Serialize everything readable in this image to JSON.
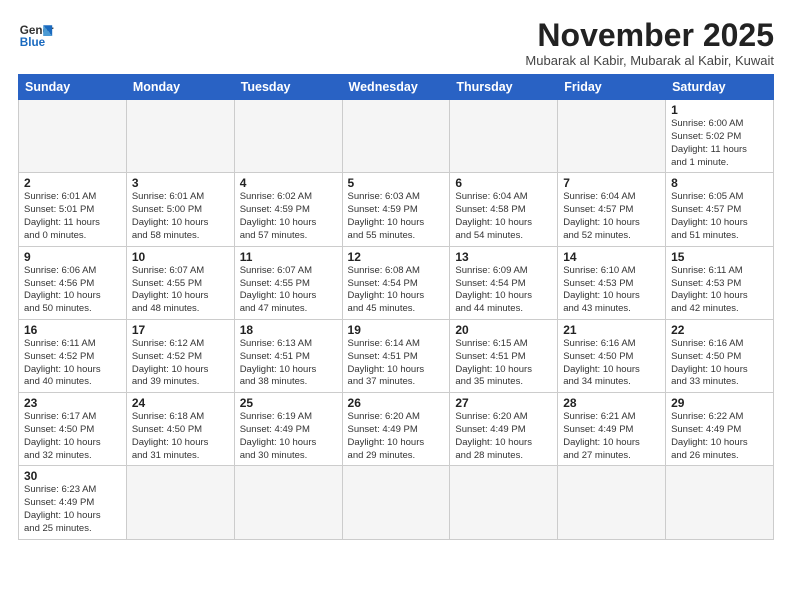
{
  "header": {
    "logo_line1": "General",
    "logo_line2": "Blue",
    "month_title": "November 2025",
    "subtitle": "Mubarak al Kabir, Mubarak al Kabir, Kuwait"
  },
  "weekdays": [
    "Sunday",
    "Monday",
    "Tuesday",
    "Wednesday",
    "Thursday",
    "Friday",
    "Saturday"
  ],
  "weeks": [
    [
      {
        "day": "",
        "info": ""
      },
      {
        "day": "",
        "info": ""
      },
      {
        "day": "",
        "info": ""
      },
      {
        "day": "",
        "info": ""
      },
      {
        "day": "",
        "info": ""
      },
      {
        "day": "",
        "info": ""
      },
      {
        "day": "1",
        "info": "Sunrise: 6:00 AM\nSunset: 5:02 PM\nDaylight: 11 hours\nand 1 minute."
      }
    ],
    [
      {
        "day": "2",
        "info": "Sunrise: 6:01 AM\nSunset: 5:01 PM\nDaylight: 11 hours\nand 0 minutes."
      },
      {
        "day": "3",
        "info": "Sunrise: 6:01 AM\nSunset: 5:00 PM\nDaylight: 10 hours\nand 58 minutes."
      },
      {
        "day": "4",
        "info": "Sunrise: 6:02 AM\nSunset: 4:59 PM\nDaylight: 10 hours\nand 57 minutes."
      },
      {
        "day": "5",
        "info": "Sunrise: 6:03 AM\nSunset: 4:59 PM\nDaylight: 10 hours\nand 55 minutes."
      },
      {
        "day": "6",
        "info": "Sunrise: 6:04 AM\nSunset: 4:58 PM\nDaylight: 10 hours\nand 54 minutes."
      },
      {
        "day": "7",
        "info": "Sunrise: 6:04 AM\nSunset: 4:57 PM\nDaylight: 10 hours\nand 52 minutes."
      },
      {
        "day": "8",
        "info": "Sunrise: 6:05 AM\nSunset: 4:57 PM\nDaylight: 10 hours\nand 51 minutes."
      }
    ],
    [
      {
        "day": "9",
        "info": "Sunrise: 6:06 AM\nSunset: 4:56 PM\nDaylight: 10 hours\nand 50 minutes."
      },
      {
        "day": "10",
        "info": "Sunrise: 6:07 AM\nSunset: 4:55 PM\nDaylight: 10 hours\nand 48 minutes."
      },
      {
        "day": "11",
        "info": "Sunrise: 6:07 AM\nSunset: 4:55 PM\nDaylight: 10 hours\nand 47 minutes."
      },
      {
        "day": "12",
        "info": "Sunrise: 6:08 AM\nSunset: 4:54 PM\nDaylight: 10 hours\nand 45 minutes."
      },
      {
        "day": "13",
        "info": "Sunrise: 6:09 AM\nSunset: 4:54 PM\nDaylight: 10 hours\nand 44 minutes."
      },
      {
        "day": "14",
        "info": "Sunrise: 6:10 AM\nSunset: 4:53 PM\nDaylight: 10 hours\nand 43 minutes."
      },
      {
        "day": "15",
        "info": "Sunrise: 6:11 AM\nSunset: 4:53 PM\nDaylight: 10 hours\nand 42 minutes."
      }
    ],
    [
      {
        "day": "16",
        "info": "Sunrise: 6:11 AM\nSunset: 4:52 PM\nDaylight: 10 hours\nand 40 minutes."
      },
      {
        "day": "17",
        "info": "Sunrise: 6:12 AM\nSunset: 4:52 PM\nDaylight: 10 hours\nand 39 minutes."
      },
      {
        "day": "18",
        "info": "Sunrise: 6:13 AM\nSunset: 4:51 PM\nDaylight: 10 hours\nand 38 minutes."
      },
      {
        "day": "19",
        "info": "Sunrise: 6:14 AM\nSunset: 4:51 PM\nDaylight: 10 hours\nand 37 minutes."
      },
      {
        "day": "20",
        "info": "Sunrise: 6:15 AM\nSunset: 4:51 PM\nDaylight: 10 hours\nand 35 minutes."
      },
      {
        "day": "21",
        "info": "Sunrise: 6:16 AM\nSunset: 4:50 PM\nDaylight: 10 hours\nand 34 minutes."
      },
      {
        "day": "22",
        "info": "Sunrise: 6:16 AM\nSunset: 4:50 PM\nDaylight: 10 hours\nand 33 minutes."
      }
    ],
    [
      {
        "day": "23",
        "info": "Sunrise: 6:17 AM\nSunset: 4:50 PM\nDaylight: 10 hours\nand 32 minutes."
      },
      {
        "day": "24",
        "info": "Sunrise: 6:18 AM\nSunset: 4:50 PM\nDaylight: 10 hours\nand 31 minutes."
      },
      {
        "day": "25",
        "info": "Sunrise: 6:19 AM\nSunset: 4:49 PM\nDaylight: 10 hours\nand 30 minutes."
      },
      {
        "day": "26",
        "info": "Sunrise: 6:20 AM\nSunset: 4:49 PM\nDaylight: 10 hours\nand 29 minutes."
      },
      {
        "day": "27",
        "info": "Sunrise: 6:20 AM\nSunset: 4:49 PM\nDaylight: 10 hours\nand 28 minutes."
      },
      {
        "day": "28",
        "info": "Sunrise: 6:21 AM\nSunset: 4:49 PM\nDaylight: 10 hours\nand 27 minutes."
      },
      {
        "day": "29",
        "info": "Sunrise: 6:22 AM\nSunset: 4:49 PM\nDaylight: 10 hours\nand 26 minutes."
      }
    ],
    [
      {
        "day": "30",
        "info": "Sunrise: 6:23 AM\nSunset: 4:49 PM\nDaylight: 10 hours\nand 25 minutes."
      },
      {
        "day": "",
        "info": ""
      },
      {
        "day": "",
        "info": ""
      },
      {
        "day": "",
        "info": ""
      },
      {
        "day": "",
        "info": ""
      },
      {
        "day": "",
        "info": ""
      },
      {
        "day": "",
        "info": ""
      }
    ]
  ]
}
